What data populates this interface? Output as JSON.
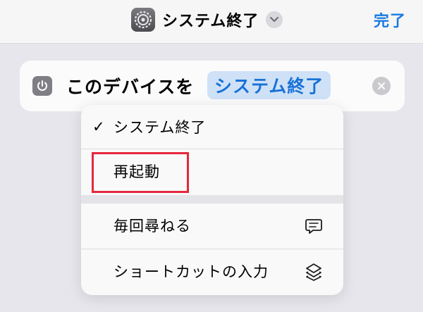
{
  "nav": {
    "title": "システム終了",
    "done_label": "完了",
    "icon": "settings-gear-icon"
  },
  "action": {
    "prefix": "このデバイスを",
    "token": "システム終了",
    "icon": "power-icon"
  },
  "menu": {
    "items": [
      {
        "label": "システム終了",
        "checked": true
      },
      {
        "label": "再起動",
        "checked": false,
        "highlighted": true
      },
      {
        "label": "毎回尋ねる",
        "icon": "speech-bubble-icon"
      },
      {
        "label": "ショートカットの入力",
        "icon": "layers-shortcut-icon"
      }
    ]
  },
  "colors": {
    "accent": "#1a7ae0",
    "token_bg": "#cfe1f7",
    "highlight": "#e5273c",
    "background": "#e7e6ec"
  }
}
